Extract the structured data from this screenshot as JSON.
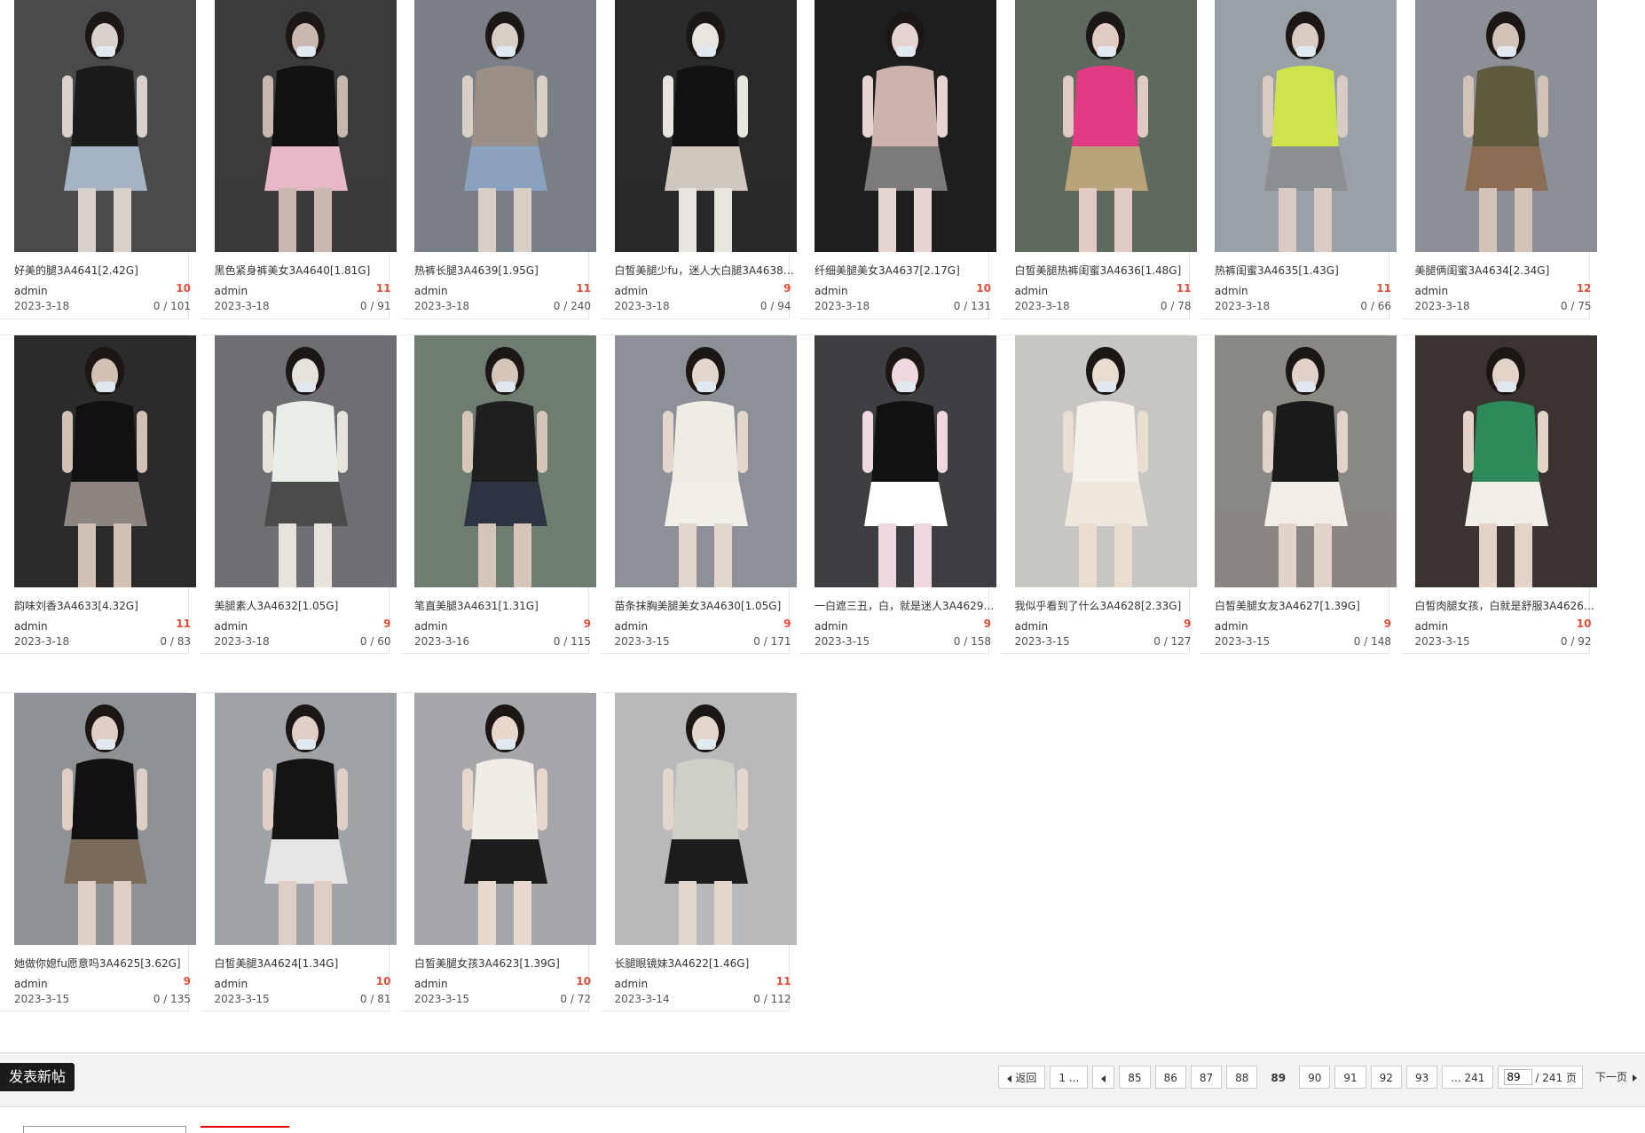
{
  "posts": [
    {
      "title": "好美的腿3A4641[2.42G]",
      "author": "admin",
      "count": "10",
      "date": "2023-3-18",
      "stats": "0 / 101"
    },
    {
      "title": "黑色紧身裤美女3A4640[1.81G]",
      "author": "admin",
      "count": "11",
      "date": "2023-3-18",
      "stats": "0 / 91"
    },
    {
      "title": "热裤长腿3A4639[1.95G]",
      "author": "admin",
      "count": "11",
      "date": "2023-3-18",
      "stats": "0 / 240"
    },
    {
      "title": "白皙美腿少fu，迷人大白腿3A4638[...",
      "author": "admin",
      "count": "9",
      "date": "2023-3-18",
      "stats": "0 / 94"
    },
    {
      "title": "纤细美腿美女3A4637[2.17G]",
      "author": "admin",
      "count": "10",
      "date": "2023-3-18",
      "stats": "0 / 131"
    },
    {
      "title": "白皙美腿热裤闺蜜3A4636[1.48G]",
      "author": "admin",
      "count": "11",
      "date": "2023-3-18",
      "stats": "0 / 78"
    },
    {
      "title": "热裤闺蜜3A4635[1.43G]",
      "author": "admin",
      "count": "11",
      "date": "2023-3-18",
      "stats": "0 / 66"
    },
    {
      "title": "美腿俩闺蜜3A4634[2.34G]",
      "author": "admin",
      "count": "12",
      "date": "2023-3-18",
      "stats": "0 / 75"
    },
    {
      "title": "韵味刘香3A4633[4.32G]",
      "author": "admin",
      "count": "11",
      "date": "2023-3-18",
      "stats": "0 / 83"
    },
    {
      "title": "美腿素人3A4632[1.05G]",
      "author": "admin",
      "count": "9",
      "date": "2023-3-18",
      "stats": "0 / 60"
    },
    {
      "title": "笔直美腿3A4631[1.31G]",
      "author": "admin",
      "count": "9",
      "date": "2023-3-16",
      "stats": "0 / 115"
    },
    {
      "title": "苗条抹胸美腿美女3A4630[1.05G]",
      "author": "admin",
      "count": "9",
      "date": "2023-3-15",
      "stats": "0 / 171"
    },
    {
      "title": "一白遮三丑，白，就是迷人3A4629[...",
      "author": "admin",
      "count": "9",
      "date": "2023-3-15",
      "stats": "0 / 158"
    },
    {
      "title": "我似乎看到了什么3A4628[2.33G]",
      "author": "admin",
      "count": "9",
      "date": "2023-3-15",
      "stats": "0 / 127"
    },
    {
      "title": "白皙美腿女友3A4627[1.39G]",
      "author": "admin",
      "count": "9",
      "date": "2023-3-15",
      "stats": "0 / 148"
    },
    {
      "title": "白皙肉腿女孩，白就是舒服3A4626[...",
      "author": "admin",
      "count": "10",
      "date": "2023-3-15",
      "stats": "0 / 92"
    },
    {
      "title": "她做你媳fu愿意吗3A4625[3.62G]",
      "author": "admin",
      "count": "9",
      "date": "2023-3-15",
      "stats": "0 / 135"
    },
    {
      "title": "白皙美腿3A4624[1.34G]",
      "author": "admin",
      "count": "10",
      "date": "2023-3-15",
      "stats": "0 / 81"
    },
    {
      "title": "白皙美腿女孩3A4623[1.39G]",
      "author": "admin",
      "count": "10",
      "date": "2023-3-15",
      "stats": "0 / 72"
    },
    {
      "title": "长腿眼镜妹3A4622[1.46G]",
      "author": "admin",
      "count": "11",
      "date": "2023-3-14",
      "stats": "0 / 112"
    }
  ],
  "toolbar": {
    "new_post_label": "发表新帖"
  },
  "pager": {
    "back_label": "返回",
    "first_label": "1 ...",
    "pages": [
      "85",
      "86",
      "87",
      "88",
      "89",
      "90",
      "91",
      "92",
      "93"
    ],
    "current": "89",
    "last_label": "... 241",
    "jump_value": "89",
    "total_label": "/ 241 页",
    "next_label": "下一页"
  },
  "colors": {
    "count": "#e14d38",
    "button_bg": "#1b1b1b",
    "bar_bg": "#f3f3f3"
  }
}
